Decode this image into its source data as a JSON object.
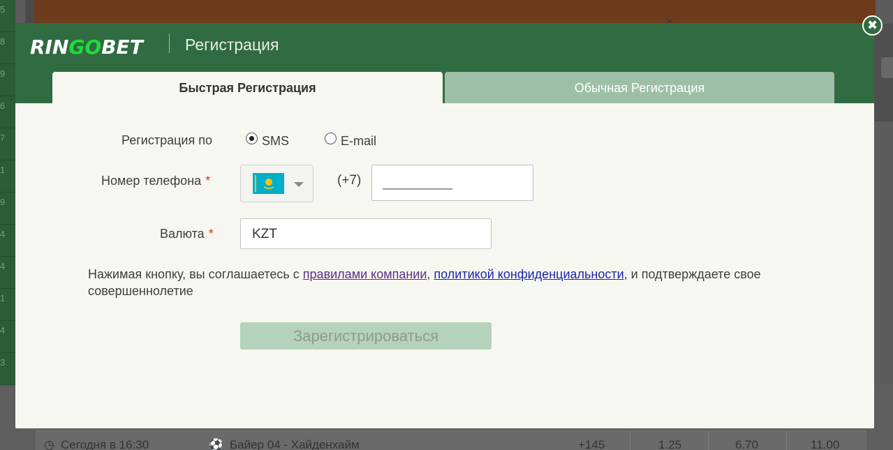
{
  "background": {
    "side_numbers": [
      "5",
      "8",
      "9",
      "6",
      "7",
      "1",
      "9",
      "4",
      "4",
      "1",
      "4",
      "3"
    ],
    "match_row": {
      "time": "Сегодня в 16:30",
      "teams": "Байер 04 - Хайденхайм",
      "more_markets": "+145",
      "odds": [
        "1.25",
        "6.70",
        "11.00"
      ]
    }
  },
  "modal": {
    "logo": {
      "part1": "RIN",
      "part2": "GO",
      "part3": "BET"
    },
    "title": "Регистрация",
    "tabs": [
      {
        "label": "Быстрая Регистрация",
        "active": true
      },
      {
        "label": "Обычная Регистрация",
        "active": false
      }
    ],
    "registration_by": {
      "label": "Регистрация по",
      "options": [
        {
          "label": "SMS",
          "selected": true
        },
        {
          "label": "E-mail",
          "selected": false
        }
      ]
    },
    "phone": {
      "label": "Номер телефона",
      "required_mark": "*",
      "country_flag": "kazakhstan-flag",
      "country_code": "(+7)",
      "placeholder": "__________",
      "value": ""
    },
    "currency": {
      "label": "Валюта",
      "required_mark": "*",
      "value": "KZT"
    },
    "terms": {
      "prefix": "Нажимая кнопку, вы соглашаетесь с ",
      "rules_link": "правилами компании",
      "separator": ", ",
      "privacy_link": "политикой конфиденциальности",
      "suffix": ", и подтверждаете свое совершеннолетие"
    },
    "submit_label": "Зарегистрироваться",
    "close_icon": "close-icon",
    "colors": {
      "header_green": "#316b41",
      "inactive_tab": "#9dbfa8",
      "submit_disabled": "#b5d2bc",
      "required_red": "#e0301e",
      "logo_go_green": "#1fdc3a"
    }
  }
}
